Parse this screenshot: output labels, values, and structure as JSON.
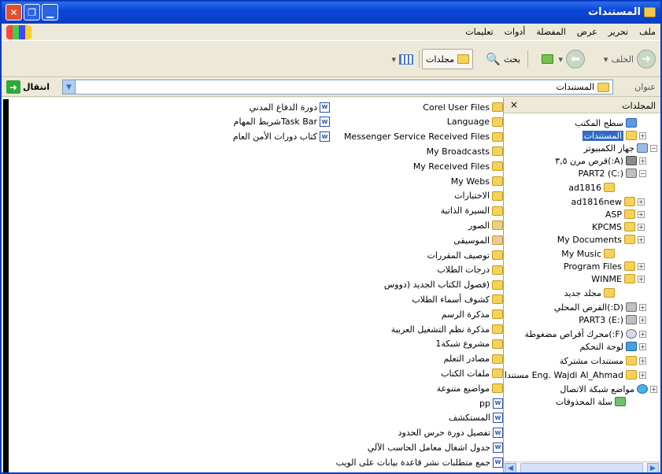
{
  "window": {
    "title": "المستندات"
  },
  "menu": [
    "ملف",
    "تحرير",
    "عرض",
    "المفضلة",
    "أدوات",
    "تعليمات"
  ],
  "toolbar": {
    "back": "الخلف",
    "search": "بحث",
    "folders": "مجلدات"
  },
  "address": {
    "label": "عنوان",
    "value": "المستندات",
    "go": "انتقال"
  },
  "folders_pane": {
    "title": "المجلدات",
    "close": "×",
    "tree": [
      {
        "label": "سطح المكتب",
        "icon": "desktop-icon",
        "expander": ""
      },
      {
        "label": "المستندات",
        "icon": "folder-icon",
        "expander": "+",
        "selected": true
      },
      {
        "label": "جهاز الكمبيوتر",
        "icon": "computer-icon",
        "expander": "−"
      },
      {
        "label": "(A:)قرص مرن ٣,٥",
        "icon": "floppy-icon",
        "expander": "+"
      },
      {
        "label": "PART2 (C:)",
        "icon": "drive-icon",
        "expander": "−"
      },
      {
        "label": "ad1816",
        "icon": "folder-icon",
        "expander": ""
      },
      {
        "label": "ad1816new",
        "icon": "folder-icon",
        "expander": "+"
      },
      {
        "label": "ASP",
        "icon": "folder-icon",
        "expander": "+"
      },
      {
        "label": "KPCMS",
        "icon": "folder-icon",
        "expander": "+"
      },
      {
        "label": "My Documents",
        "icon": "folder-icon",
        "expander": "+"
      },
      {
        "label": "My Music",
        "icon": "folder-icon",
        "expander": ""
      },
      {
        "label": "Program Files",
        "icon": "folder-icon",
        "expander": "+"
      },
      {
        "label": "WINME",
        "icon": "folder-icon",
        "expander": "+"
      },
      {
        "label": "مجلد جديد",
        "icon": "folder-icon",
        "expander": ""
      },
      {
        "label": "(D:)القرص المحلي",
        "icon": "drive-icon",
        "expander": "+"
      },
      {
        "label": "PART3 (E:)",
        "icon": "drive-icon",
        "expander": "+"
      },
      {
        "label": "(F:)محرك أقراص مضغوطة",
        "icon": "cd-icon",
        "expander": "+"
      },
      {
        "label": "لوحة التحكم",
        "icon": "control-panel-icon",
        "expander": "+"
      },
      {
        "label": "مستندات مشتركة",
        "icon": "folder-icon",
        "expander": "+"
      },
      {
        "label": "Eng. Wajdi Al_Ahmad مستندات",
        "icon": "folder-icon",
        "expander": "+"
      },
      {
        "label": "مواضع شبكة الاتصال",
        "icon": "network-icon",
        "expander": "+"
      },
      {
        "label": "سلة المحذوفات",
        "icon": "recycle-bin-icon",
        "expander": ""
      }
    ]
  },
  "files_col1": [
    {
      "label": "Corel User Files",
      "icon": "folder-icon"
    },
    {
      "label": "Language",
      "icon": "folder-icon"
    },
    {
      "label": "Messenger Service Received Files",
      "icon": "folder-icon"
    },
    {
      "label": "My Broadcasts",
      "icon": "folder-icon"
    },
    {
      "label": "My Received Files",
      "icon": "folder-icon"
    },
    {
      "label": "My Webs",
      "icon": "folder-icon"
    },
    {
      "label": "الاختبارات",
      "icon": "folder-icon"
    },
    {
      "label": "السيرة الذاتية",
      "icon": "folder-icon"
    },
    {
      "label": "الصور",
      "icon": "pictures-folder-icon"
    },
    {
      "label": "الموسيقى",
      "icon": "music-folder-icon"
    },
    {
      "label": "توصيف المقررات",
      "icon": "folder-icon"
    },
    {
      "label": "درجات الطلاب",
      "icon": "folder-icon"
    },
    {
      "label": "(فصول الكتاب الجديد (دووس",
      "icon": "folder-icon"
    },
    {
      "label": "كشوف أسماء الطلاب",
      "icon": "folder-icon"
    },
    {
      "label": "مذكرة الرسم",
      "icon": "folder-icon"
    },
    {
      "label": "مذكرة نظم التشغيل العربية",
      "icon": "folder-icon"
    },
    {
      "label": "مشروع شبكة1",
      "icon": "folder-icon"
    },
    {
      "label": "مصادر التعلم",
      "icon": "folder-icon"
    },
    {
      "label": "ملفات الكتاب",
      "icon": "folder-icon"
    },
    {
      "label": "مواضيع متنوعة",
      "icon": "folder-icon"
    },
    {
      "label": "pp",
      "icon": "word-doc-icon"
    },
    {
      "label": "المستكشف",
      "icon": "word-doc-icon"
    },
    {
      "label": "تفصيل دورة حرس الحدود",
      "icon": "word-doc-icon"
    },
    {
      "label": "جدول اشغال معامل الحاسب الآلي",
      "icon": "word-doc-icon"
    },
    {
      "label": "جمع متطلبات نشر قاعدة بيانات على الويب",
      "icon": "word-doc-icon"
    }
  ],
  "files_col2": [
    {
      "label": "دورة الدفاع المدني",
      "icon": "word-doc-icon"
    },
    {
      "label": "Task Barشريط المهام",
      "icon": "word-doc-icon"
    },
    {
      "label": "كتاب دورات الأمن العام",
      "icon": "word-doc-icon"
    }
  ],
  "colors": {
    "titlebar": "#0a46d8",
    "selection": "#316ac5",
    "folder": "#f5d25c"
  }
}
